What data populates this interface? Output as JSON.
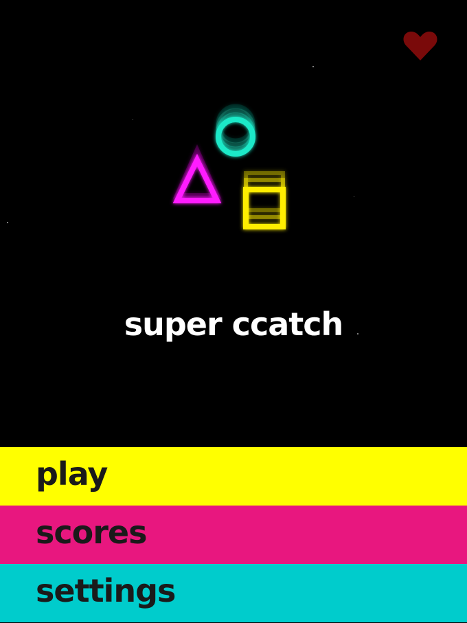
{
  "title": "super ccatch",
  "menu": {
    "play": "play",
    "scores": "scores",
    "settings": "settings"
  },
  "icons": {
    "favorite": "heart-icon",
    "shapes": [
      "circle-icon",
      "triangle-icon",
      "square-icon"
    ]
  },
  "colors": {
    "background": "#000000",
    "heart": "#7a0a0a",
    "circle": "#1de9c8",
    "triangle": "#ff1aff",
    "square": "#ffee00",
    "play_bg": "#ffff00",
    "scores_bg": "#e8177f",
    "settings_bg": "#00cccc",
    "menu_text": "#1a1a1a",
    "title_text": "#ffffff"
  }
}
